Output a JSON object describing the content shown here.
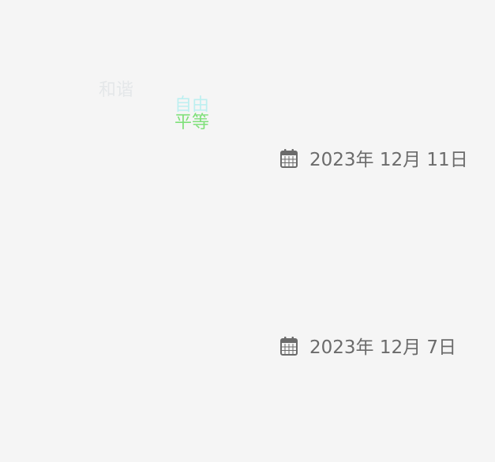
{
  "floating_words": [
    {
      "text": "和谐",
      "color": "#e4e7e9"
    },
    {
      "text": "自由",
      "color": "#bdeff0"
    },
    {
      "text": "平等",
      "color": "#7fe07a"
    }
  ],
  "posts": [
    {
      "date": "2023年 12月 11日",
      "icon": "calendar-icon"
    },
    {
      "date": "2023年 12月 7日",
      "icon": "calendar-icon"
    }
  ],
  "colors": {
    "background": "#f5f5f5",
    "date_text": "#6b6b6b",
    "icon": "#6b6b6b"
  }
}
